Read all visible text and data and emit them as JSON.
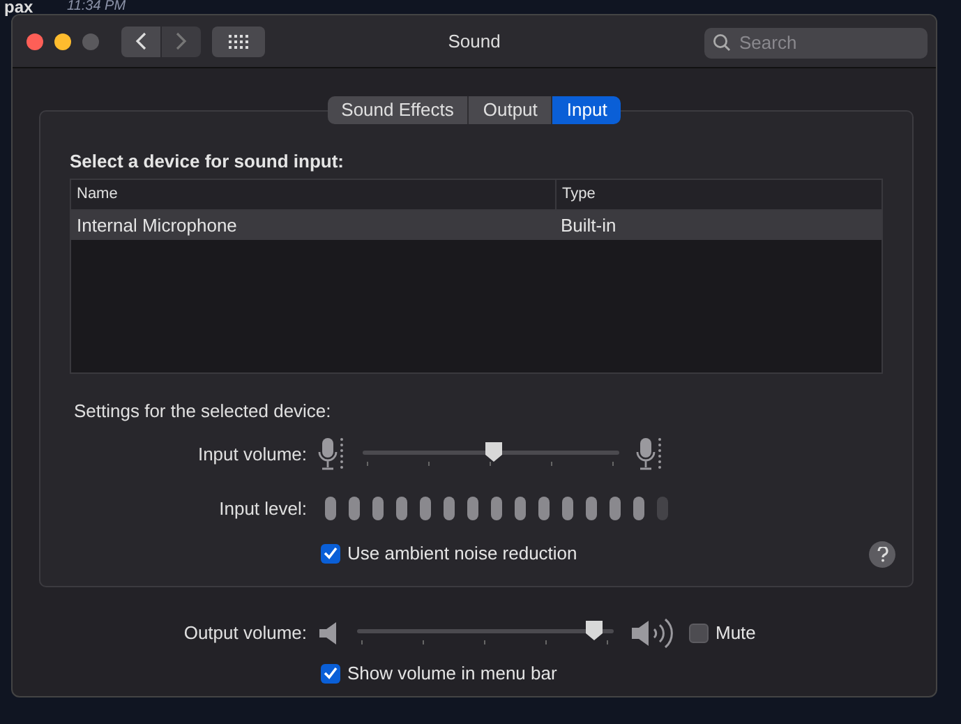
{
  "background": {
    "texts": [
      "pax",
      "11:34 PM"
    ]
  },
  "window": {
    "title": "Sound",
    "search": {
      "placeholder": "Search"
    }
  },
  "tabs": [
    {
      "label": "Sound Effects",
      "selected": false
    },
    {
      "label": "Output",
      "selected": false
    },
    {
      "label": "Input",
      "selected": true
    }
  ],
  "input_panel": {
    "heading": "Select a device for sound input:",
    "table": {
      "columns": [
        "Name",
        "Type"
      ],
      "rows": [
        {
          "cells": [
            "Internal Microphone",
            "Built-in"
          ],
          "selected": true
        }
      ]
    },
    "settings_heading": "Settings for the selected device:",
    "input_volume": {
      "label": "Input volume:",
      "level": 0.51
    },
    "input_level": {
      "label": "Input level:",
      "level": 0.93
    },
    "noise_reduction": {
      "label": "Use ambient noise reduction",
      "checked": true
    }
  },
  "output_volume": {
    "label": "Output volume:",
    "level": 0.96
  },
  "mute": {
    "label": "Mute",
    "checked": false
  },
  "show_in_menu_bar": {
    "label": "Show volume in menu bar",
    "checked": true
  }
}
